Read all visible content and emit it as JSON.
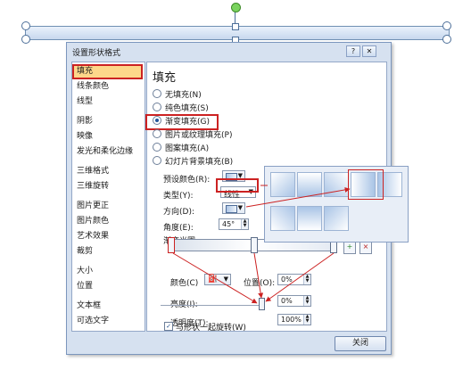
{
  "dialog": {
    "title": "设置形状格式",
    "minimize_glyph": "?",
    "close_glyph": "✕",
    "close_button": "关闭"
  },
  "sidebar": {
    "items": [
      {
        "label": "填充",
        "selected": true
      },
      {
        "label": "线条颜色"
      },
      {
        "label": "线型"
      },
      {
        "label": "阴影"
      },
      {
        "label": "映像"
      },
      {
        "label": "发光和柔化边缘"
      },
      {
        "label": "三维格式"
      },
      {
        "label": "三维旋转"
      },
      {
        "label": "图片更正"
      },
      {
        "label": "图片颜色"
      },
      {
        "label": "艺术效果"
      },
      {
        "label": "裁剪"
      },
      {
        "label": "大小"
      },
      {
        "label": "位置"
      },
      {
        "label": "文本框"
      },
      {
        "label": "可选文字"
      }
    ]
  },
  "fill": {
    "heading": "填充",
    "options": [
      {
        "label": "无填充(N)",
        "selected": false
      },
      {
        "label": "纯色填充(S)",
        "selected": false
      },
      {
        "label": "渐变填充(G)",
        "selected": true
      },
      {
        "label": "图片或纹理填充(P)",
        "selected": false
      },
      {
        "label": "图案填充(A)",
        "selected": false
      },
      {
        "label": "幻灯片背景填充(B)",
        "selected": false
      }
    ],
    "preset_label": "预设颜色(R):",
    "type_label": "类型(Y):",
    "type_value": "线性",
    "direction_label": "方向(D):",
    "angle_label": "角度(E):",
    "angle_value": "45°",
    "stops_label": "渐变光圈",
    "color_label": "颜色(C)",
    "position_label": "位置(O):",
    "position_value": "0%",
    "brightness_label": "亮度(I):",
    "brightness_value": "0%",
    "transparency_label": "透明度(T):",
    "transparency_value": "100%",
    "transparency_level": 1.0,
    "rotate_label": "与形状一起旋转(W)",
    "rotate_checked": true
  },
  "icons": {
    "add_stop": "plus-icon",
    "remove_stop": "minus-icon",
    "paint_bucket": "paint-bucket-icon",
    "dropdown": "chevron-down-icon"
  },
  "colors": {
    "accent_red": "#cc2222",
    "highlight": "#fdd78a",
    "dialog_bg": "#d6e1f0"
  }
}
